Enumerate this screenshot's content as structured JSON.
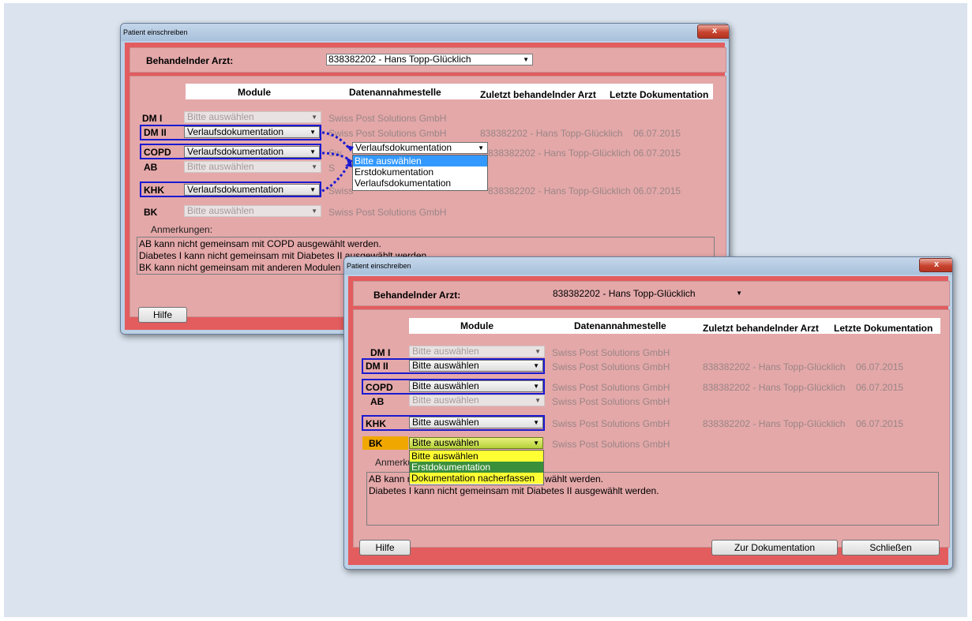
{
  "window1": {
    "title": "Patient einschreiben",
    "close": "x",
    "arzt_label": "Behandelnder Arzt:",
    "arzt_value": "838382202 - Hans Topp-Glücklich",
    "headers": {
      "module": "Module",
      "stelle": "Datenannahmestelle",
      "arzt": "Zuletzt behandelnder Arzt",
      "doku": "Letzte Dokumentation"
    },
    "rows": [
      {
        "code": "DM I",
        "module": "Bitte auswählen",
        "stelle": "Swiss Post Solutions GmbH",
        "arzt": "",
        "datum": ""
      },
      {
        "code": "DM II",
        "module": "Verlaufsdokumentation",
        "stelle": "Swiss Post Solutions GmbH",
        "arzt": "838382202 - Hans Topp-Glücklich",
        "datum": "06.07.2015"
      },
      {
        "code": "COPD",
        "module": "Verlaufsdokumentation",
        "stelle": "Sw",
        "arzt": "838382202 - Hans Topp-Glücklich",
        "datum": "06.07.2015"
      },
      {
        "code": "AB",
        "module": "Bitte auswählen",
        "stelle": "S",
        "arzt": "",
        "datum": ""
      },
      {
        "code": "KHK",
        "module": "Verlaufsdokumentation",
        "stelle": "Swiss",
        "arzt": "838382202 - Hans Topp-Glücklich",
        "datum": "06.07.2015"
      },
      {
        "code": "BK",
        "module": "Bitte auswählen",
        "stelle": "Swiss Post Solutions GmbH",
        "arzt": "",
        "datum": ""
      }
    ],
    "popup": {
      "value": "Verlaufsdokumentation",
      "options": [
        "Bitte auswählen",
        "Erstdokumentation",
        "Verlaufsdokumentation"
      ],
      "selected": 0
    },
    "anmerkungen_label": "Anmerkungen:",
    "notes": [
      "AB kann nicht gemeinsam mit COPD ausgewählt werden.",
      "Diabetes I kann nicht gemeinsam mit Diabetes II ausgewählt werden.",
      "BK kann nicht gemeinsam mit anderen Modulen au"
    ],
    "hilfe": "Hilfe"
  },
  "window2": {
    "title": "Patient einschreiben",
    "close": "x",
    "arzt_label": "Behandelnder Arzt:",
    "arzt_value": "838382202 - Hans Topp-Glücklich",
    "headers": {
      "module": "Module",
      "stelle": "Datenannahmestelle",
      "arzt": "Zuletzt behandelnder Arzt",
      "doku": "Letzte Dokumentation"
    },
    "rows": [
      {
        "code": "DM I",
        "module": "Bitte auswählen",
        "stelle": "Swiss Post Solutions GmbH",
        "arzt": "",
        "datum": ""
      },
      {
        "code": "DM II",
        "module": "Bitte auswählen",
        "stelle": "Swiss Post Solutions GmbH",
        "arzt": "838382202 - Hans Topp-Glücklich",
        "datum": "06.07.2015"
      },
      {
        "code": "COPD",
        "module": "Bitte auswählen",
        "stelle": "Swiss Post Solutions GmbH",
        "arzt": "838382202 - Hans Topp-Glücklich",
        "datum": "06.07.2015"
      },
      {
        "code": "AB",
        "module": "Bitte auswählen",
        "stelle": "Swiss Post Solutions GmbH",
        "arzt": "",
        "datum": ""
      },
      {
        "code": "KHK",
        "module": "Bitte auswählen",
        "stelle": "Swiss Post Solutions GmbH",
        "arzt": "838382202 - Hans Topp-Glücklich",
        "datum": "06.07.2015"
      },
      {
        "code": "BK",
        "module": "Bitte auswählen",
        "stelle": "Swiss Post Solutions GmbH",
        "arzt": "",
        "datum": ""
      }
    ],
    "popup": {
      "options": [
        "Bitte auswählen",
        "Erstdokumentation",
        "Dokumentation nacherfassen"
      ],
      "selected": 1
    },
    "anmerkungen_label": "Anmerku",
    "notes": [
      "AB kann n",
      "wählt werden.",
      "Diabetes I kann nicht gemeinsam mit Diabetes II ausgewählt werden."
    ],
    "hilfe": "Hilfe",
    "zur_doku": "Zur Dokumentation",
    "schliessen": "Schließen"
  },
  "colors": {
    "window_red": "#e35c5e",
    "panel_pink": "#e4a8a9",
    "highlight_blue": "#1a1ad0",
    "bk_orange": "#f0a800",
    "dropdown_yellow": "#ffff33",
    "dropdown_green": "#3a8f3a"
  }
}
